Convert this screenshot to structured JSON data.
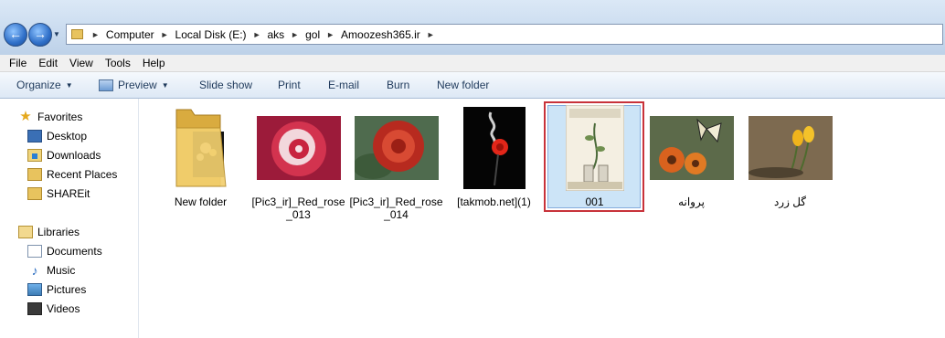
{
  "address": {
    "segments": [
      "Computer",
      "Local Disk (E:)",
      "aks",
      "gol",
      "Amoozesh365.ir"
    ]
  },
  "menu": [
    "File",
    "Edit",
    "View",
    "Tools",
    "Help"
  ],
  "toolbar": {
    "organize": "Organize",
    "preview": "Preview",
    "slideshow": "Slide show",
    "print": "Print",
    "email": "E-mail",
    "burn": "Burn",
    "new_folder": "New folder"
  },
  "nav": {
    "favorites": "Favorites",
    "desktop": "Desktop",
    "downloads": "Downloads",
    "recent": "Recent Places",
    "shareit": "SHAREit",
    "libraries": "Libraries",
    "documents": "Documents",
    "music": "Music",
    "pictures": "Pictures",
    "videos": "Videos"
  },
  "files": [
    {
      "label": "New folder",
      "kind": "folder"
    },
    {
      "label": "[Pic3_ir]_Red_rose_013",
      "kind": "rose-pink"
    },
    {
      "label": "[Pic3_ir]_Red_rose_014",
      "kind": "rose-red"
    },
    {
      "label": "[takmob.net](1)",
      "kind": "rose-dark"
    },
    {
      "label": "001",
      "kind": "book",
      "selected": true
    },
    {
      "label": "پروانه",
      "kind": "butterfly"
    },
    {
      "label": "گل زرد",
      "kind": "tulips"
    }
  ],
  "colors": {
    "selection_border": "#c8323a",
    "selection_fill": "#cce4f7",
    "toolbar_text": "#1e395b"
  }
}
